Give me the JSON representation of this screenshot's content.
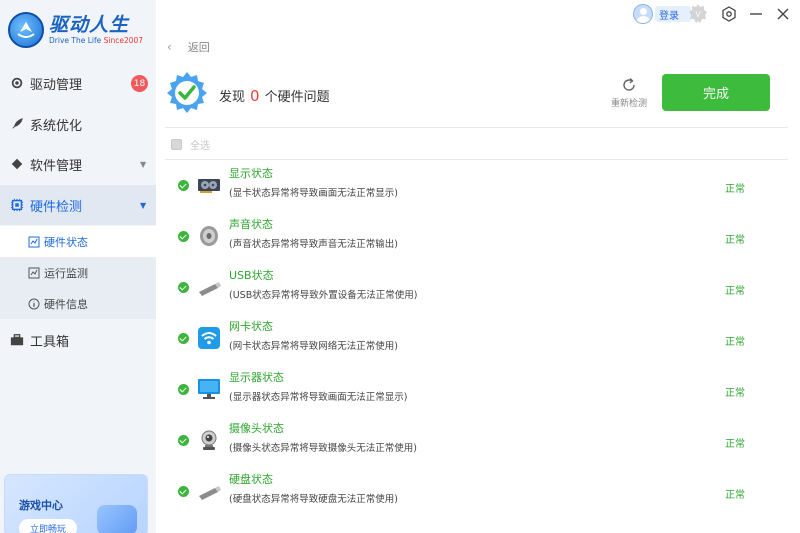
{
  "app": {
    "title": "驱动人生",
    "subtitle_prefix": "Drive The Life",
    "subtitle_since": "Since2007"
  },
  "topbar": {
    "login_label": "登录"
  },
  "sidebar": {
    "items": [
      {
        "label": "驱动管理",
        "badge": "18"
      },
      {
        "label": "系统优化"
      },
      {
        "label": "软件管理"
      },
      {
        "label": "硬件检测"
      },
      {
        "label": "工具箱"
      }
    ],
    "sub_items": [
      {
        "label": "硬件状态"
      },
      {
        "label": "运行监测"
      },
      {
        "label": "硬件信息"
      }
    ],
    "game_card": {
      "title": "游戏中心",
      "button": "立即畅玩"
    }
  },
  "main": {
    "back_label": "返回",
    "summary_prefix": "发现",
    "problem_count": "0",
    "summary_suffix": "个硬件问题",
    "recheck_label": "重新检测",
    "done_label": "完成",
    "select_all_label": "全选",
    "rows": [
      {
        "title": "显示状态",
        "desc": "(显卡状态异常将导致画面无法正常显示)",
        "status": "正常",
        "icon": "graphics-card-icon"
      },
      {
        "title": "声音状态",
        "desc": "(声音状态异常将导致声音无法正常输出)",
        "status": "正常",
        "icon": "speaker-icon"
      },
      {
        "title": "USB状态",
        "desc": "(USB状态异常将导致外置设备无法正常使用)",
        "status": "正常",
        "icon": "usb-drive-icon"
      },
      {
        "title": "网卡状态",
        "desc": "(网卡状态异常将导致网络无法正常使用)",
        "status": "正常",
        "icon": "wifi-icon"
      },
      {
        "title": "显示器状态",
        "desc": "(显示器状态异常将导致画面无法正常显示)",
        "status": "正常",
        "icon": "monitor-icon"
      },
      {
        "title": "摄像头状态",
        "desc": "(摄像头状态异常将导致摄像头无法正常使用)",
        "status": "正常",
        "icon": "webcam-icon"
      },
      {
        "title": "硬盘状态",
        "desc": "(硬盘状态异常将导致硬盘无法正常使用)",
        "status": "正常",
        "icon": "hard-disk-icon"
      }
    ]
  },
  "colors": {
    "accent_blue": "#1d6ae0",
    "ok_green": "#3bb53b",
    "done_button": "#3dbb3d",
    "alert_red": "#e8413a"
  }
}
